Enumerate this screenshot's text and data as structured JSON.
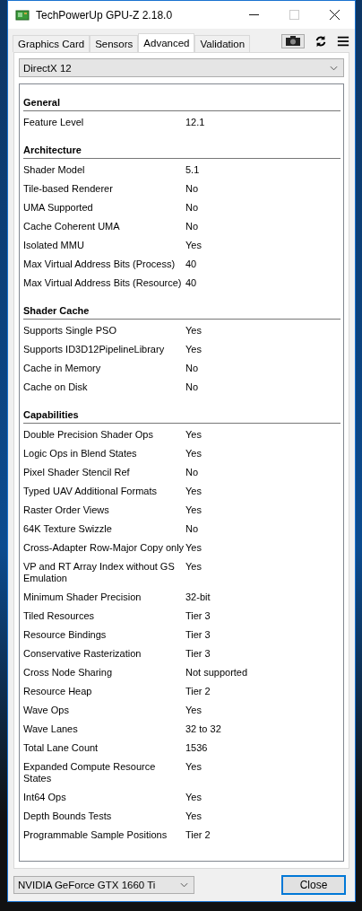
{
  "window": {
    "title": "TechPowerUp GPU-Z 2.18.0"
  },
  "tabs": [
    {
      "label": "Graphics Card",
      "selected": false
    },
    {
      "label": "Sensors",
      "selected": false
    },
    {
      "label": "Advanced",
      "selected": true
    },
    {
      "label": "Validation",
      "selected": false
    }
  ],
  "api_select": {
    "value": "DirectX 12"
  },
  "sections": [
    {
      "title": "General",
      "rows": [
        {
          "label": "Feature Level",
          "value": "12.1"
        }
      ]
    },
    {
      "title": "Architecture",
      "rows": [
        {
          "label": "Shader Model",
          "value": "5.1"
        },
        {
          "label": "Tile-based Renderer",
          "value": "No"
        },
        {
          "label": "UMA Supported",
          "value": "No"
        },
        {
          "label": "Cache Coherent UMA",
          "value": "No"
        },
        {
          "label": "Isolated MMU",
          "value": "Yes"
        },
        {
          "label": "Max Virtual Address Bits (Process)",
          "value": "40"
        },
        {
          "label": "Max Virtual Address Bits (Resource)",
          "value": "40"
        }
      ]
    },
    {
      "title": "Shader Cache",
      "rows": [
        {
          "label": "Supports Single PSO",
          "value": "Yes"
        },
        {
          "label": "Supports ID3D12PipelineLibrary",
          "value": "Yes"
        },
        {
          "label": "Cache in Memory",
          "value": "No"
        },
        {
          "label": "Cache on Disk",
          "value": "No"
        }
      ]
    },
    {
      "title": "Capabilities",
      "rows": [
        {
          "label": "Double Precision Shader Ops",
          "value": "Yes"
        },
        {
          "label": "Logic Ops in Blend States",
          "value": "Yes"
        },
        {
          "label": "Pixel Shader Stencil Ref",
          "value": "No"
        },
        {
          "label": "Typed UAV Additional Formats",
          "value": "Yes"
        },
        {
          "label": "Raster Order Views",
          "value": "Yes"
        },
        {
          "label": "64K Texture Swizzle",
          "value": "No"
        },
        {
          "label": "Cross-Adapter Row-Major Copy only",
          "value": "Yes"
        },
        {
          "label": "VP and RT Array Index without GS Emulation",
          "value": "Yes"
        },
        {
          "label": "Minimum Shader Precision",
          "value": "32-bit"
        },
        {
          "label": "Tiled Resources",
          "value": "Tier 3"
        },
        {
          "label": "Resource Bindings",
          "value": "Tier 3"
        },
        {
          "label": "Conservative Rasterization",
          "value": "Tier 3"
        },
        {
          "label": "Cross Node Sharing",
          "value": "Not supported"
        },
        {
          "label": "Resource Heap",
          "value": "Tier 2"
        },
        {
          "label": "Wave Ops",
          "value": "Yes"
        },
        {
          "label": "Wave Lanes",
          "value": "32 to 32"
        },
        {
          "label": "Total Lane Count",
          "value": "1536"
        },
        {
          "label": "Expanded Compute Resource States",
          "value": "Yes"
        },
        {
          "label": "Int64 Ops",
          "value": "Yes"
        },
        {
          "label": "Depth Bounds Tests",
          "value": "Yes"
        },
        {
          "label": "Programmable Sample Positions",
          "value": "Tier 2"
        }
      ]
    }
  ],
  "gpu_select": {
    "value": "NVIDIA GeForce GTX 1660 Ti"
  },
  "close_button": {
    "label": "Close",
    "focused": true
  }
}
